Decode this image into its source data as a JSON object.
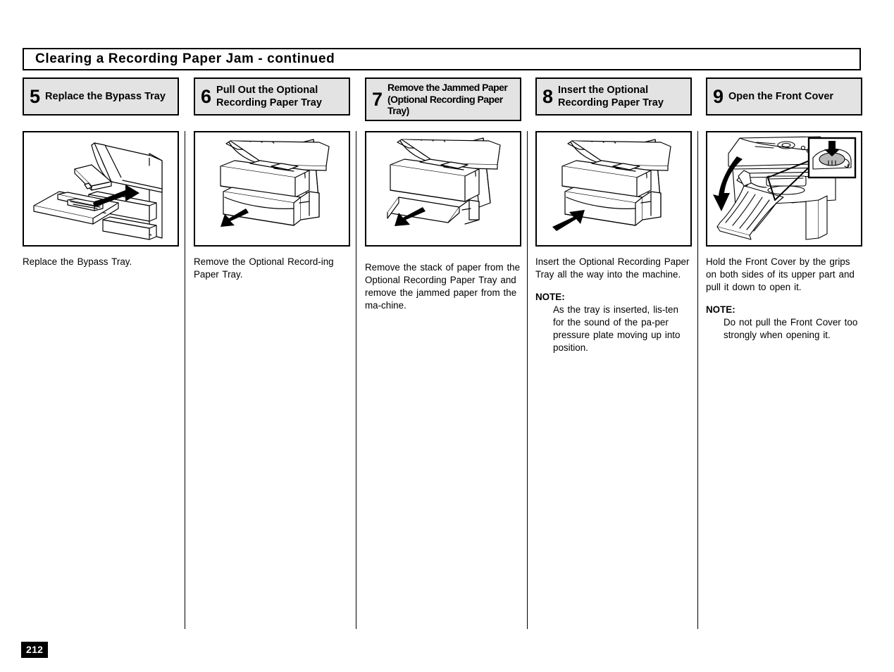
{
  "page": {
    "title": "Clearing a Recording Paper Jam - continued",
    "page_number": "212",
    "note_label": "NOTE:"
  },
  "steps": [
    {
      "number": "5",
      "title": "Replace the Bypass Tray",
      "figure": "bypass-tray-insert-illustration",
      "caption": "Replace the Bypass Tray.",
      "note": ""
    },
    {
      "number": "6",
      "title": "Pull Out the Optional Recording Paper Tray",
      "figure": "paper-tray-pull-out-illustration",
      "caption": "Remove the Optional Record-ing  Paper Tray.",
      "note": ""
    },
    {
      "number": "7",
      "title": "Remove the Jammed Paper (Optional Recording Paper Tray)",
      "figure": "jammed-paper-removal-illustration",
      "caption": "Remove the stack of paper from the Optional Recording Paper Tray and remove the jammed paper from the ma-chine.",
      "note": ""
    },
    {
      "number": "8",
      "title": "Insert the Optional Recording Paper Tray",
      "figure": "paper-tray-insert-illustration",
      "caption": "Insert the Optional Recording Paper Tray all the way into the machine.",
      "note": "As the tray is inserted, lis-ten for the sound of the pa-per pressure plate moving up into position."
    },
    {
      "number": "9",
      "title": "Open the Front Cover",
      "figure": "front-cover-open-illustration",
      "caption": "Hold the Front Cover by the grips on both sides of its upper part and pull it down to open it.",
      "note": "Do not pull the Front Cover too strongly when opening it."
    }
  ],
  "colors": {
    "header_fill": "#e3e3e3",
    "line": "#000000",
    "page_badge_bg": "#000000",
    "page_badge_text": "#ffffff"
  }
}
